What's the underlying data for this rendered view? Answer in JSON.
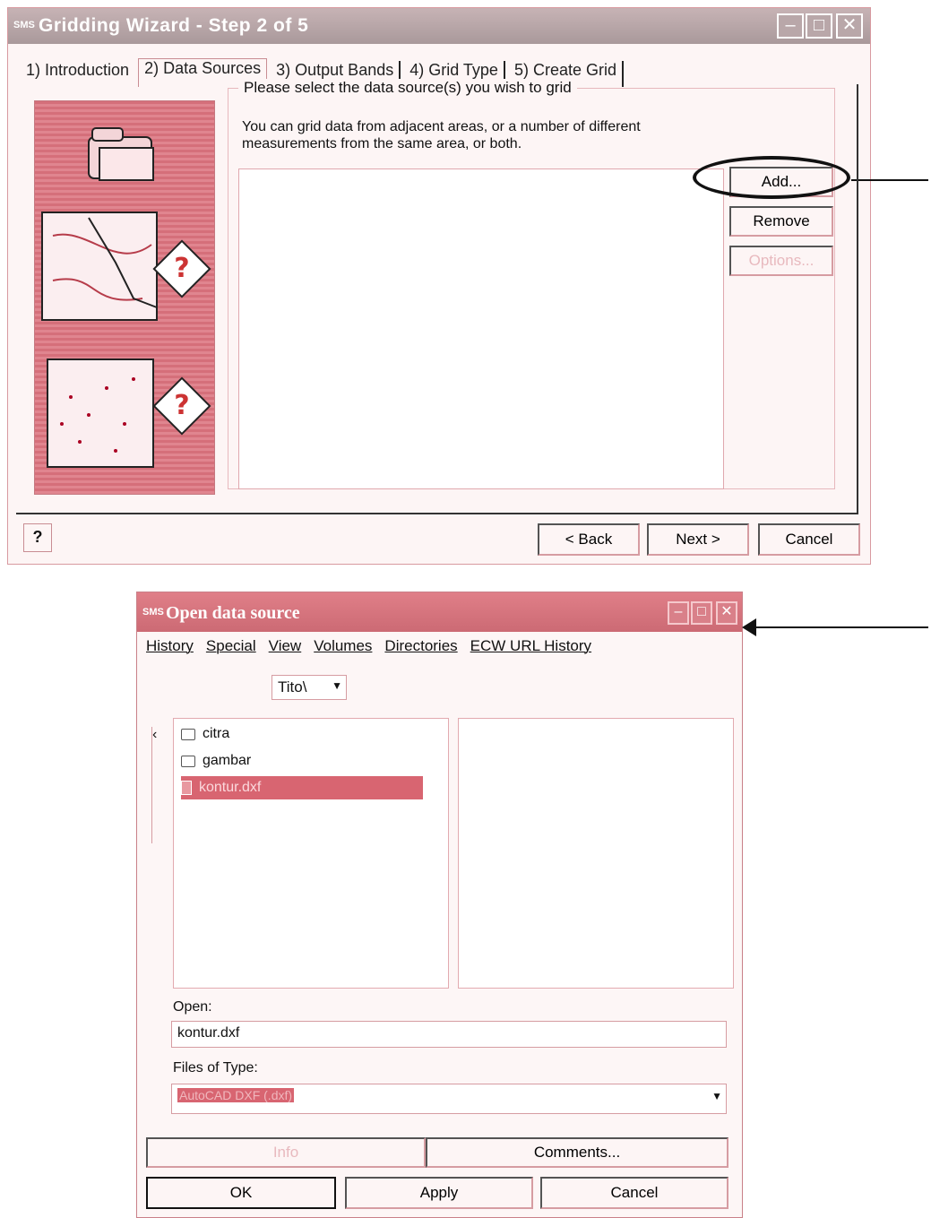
{
  "wizard": {
    "app_logo": "SMS",
    "title": "Gridding Wizard - Step 2 of 5",
    "tabs": [
      "1) Introduction",
      "2) Data Sources",
      "3) Output Bands",
      "4) Grid Type",
      "5) Create Grid"
    ],
    "active_tab": "2) Data Sources",
    "group_legend": "Please select the data source(s) you wish to grid",
    "description": "You can grid data from adjacent areas, or a number of different measurements from the same area, or both.",
    "buttons": {
      "add": "Add...",
      "remove": "Remove",
      "options": "Options..."
    },
    "nav": {
      "back": "< Back",
      "next": "Next >",
      "cancel": "Cancel"
    },
    "help_icon": "?"
  },
  "open_dialog": {
    "app_logo": "SMS",
    "title": "Open data source",
    "menu": [
      "History",
      "Special",
      "View",
      "Volumes",
      "Directories",
      "ECW URL History"
    ],
    "path": "Tito\\",
    "files": [
      {
        "name": "citra",
        "kind": "folder"
      },
      {
        "name": "gambar",
        "kind": "folder"
      },
      {
        "name": "kontur.dxf",
        "kind": "file",
        "selected": true
      }
    ],
    "open_label": "Open:",
    "open_value": "kontur.dxf",
    "files_of_type_label": "Files of Type:",
    "files_of_type_value": "AutoCAD DXF (.dxf)",
    "buttons": {
      "info": "Info",
      "comments": "Comments...",
      "ok": "OK",
      "apply": "Apply",
      "cancel": "Cancel"
    }
  },
  "colors": {
    "accent": "#d86571",
    "title_bar": "#cc6a74"
  }
}
